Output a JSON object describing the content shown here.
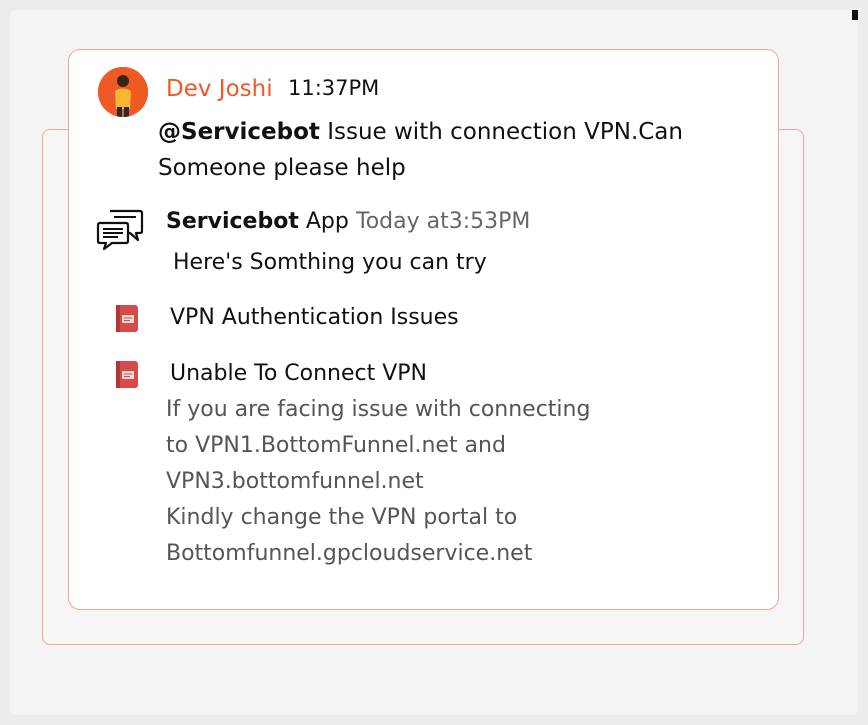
{
  "message": {
    "author": "Dev Joshi",
    "time": "11:37PM",
    "mention": "@Servicebot",
    "text_line1": " Issue with connection VPN.Can",
    "text_line2": "Someone please help"
  },
  "reply": {
    "bot_name": "Servicebot",
    "bot_suffix": " App",
    "time": "Today at3:53PM",
    "intro": "Here's Somthing you can try",
    "articles": [
      {
        "title": "VPN Authentication Issues"
      },
      {
        "title": "Unable To Connect VPN",
        "description": [
          "If you are facing issue with connecting",
          "to VPN1.BottomFunnel.net and",
          "VPN3.bottomfunnel.net",
          "Kindly change the VPN portal to",
          "Bottomfunnel.gpcloudservice.net"
        ]
      }
    ]
  },
  "colors": {
    "accent": "#ef5a24",
    "card_border": "#f0a78f",
    "book": "#d64a4a"
  },
  "icons": {
    "avatar": "user-avatar",
    "bot": "chat-bubbles-icon",
    "article": "book-icon"
  }
}
